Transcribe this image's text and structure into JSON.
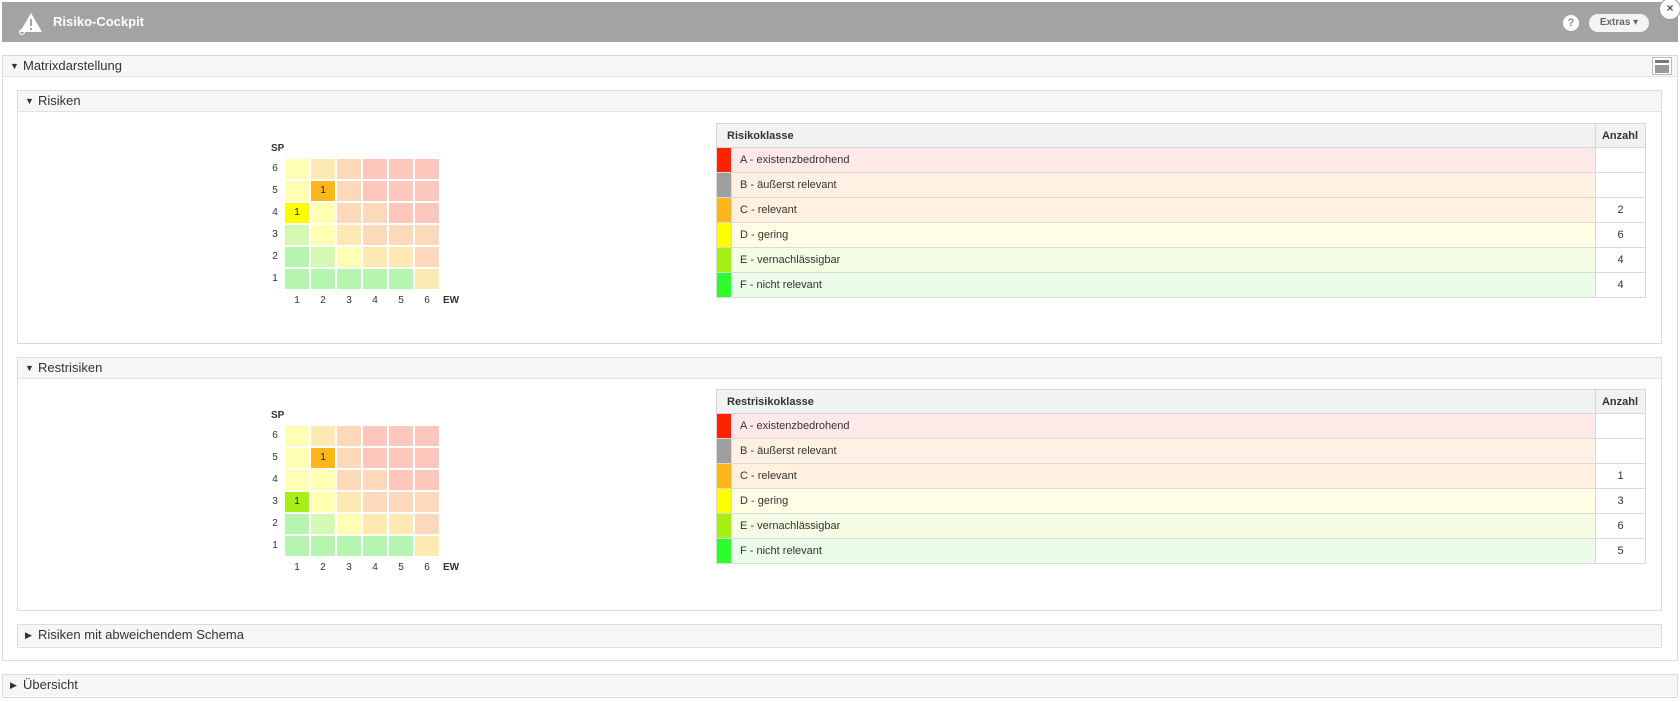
{
  "app": {
    "title": "Risiko-Cockpit",
    "help_icon": "?",
    "extras_label": "Extras ▾",
    "close_icon": "×"
  },
  "panels": {
    "matrix": {
      "title": "Matrixdarstellung"
    },
    "risks": {
      "title": "Risiken"
    },
    "residual": {
      "title": "Restrisiken"
    },
    "deviating": {
      "title": "Risiken mit abweichendem Schema"
    },
    "overview": {
      "title": "Übersicht"
    }
  },
  "matrix_axes": {
    "ylabel": "SP",
    "xlabel": "EW",
    "ticks": [
      "1",
      "2",
      "3",
      "4",
      "5",
      "6"
    ]
  },
  "palette": {
    "A": "#ff2200",
    "B": "#9e9e9e",
    "C": "#ffb61e",
    "D": "#ffff00",
    "E": "#a6ef17",
    "F": "#2dfc2d",
    "rowA": "#ffe8e8",
    "rowB": "#fff0e4",
    "rowC": "#fff0e0",
    "rowD": "#fffde4",
    "rowE": "#f5fce4",
    "rowF": "#eafbe8",
    "cell_green": "#b6f5b0",
    "cell_lightgreen": "#d4f9b2",
    "cell_yellow": "#feffb2",
    "cell_cream": "#fde9b2",
    "cell_peach": "#fdd9bc",
    "cell_red": "#fdc7bd"
  },
  "matrix_colors": [
    [
      "cell_yellow",
      "cell_cream",
      "cell_peach",
      "cell_red",
      "cell_red",
      "cell_red"
    ],
    [
      "cell_yellow",
      "cell_cream",
      "cell_peach",
      "cell_red",
      "cell_red",
      "cell_red"
    ],
    [
      "cell_yellow",
      "cell_yellow",
      "cell_peach",
      "cell_peach",
      "cell_red",
      "cell_red"
    ],
    [
      "cell_lightgreen",
      "cell_yellow",
      "cell_cream",
      "cell_peach",
      "cell_peach",
      "cell_peach"
    ],
    [
      "cell_green",
      "cell_lightgreen",
      "cell_yellow",
      "cell_cream",
      "cell_cream",
      "cell_peach"
    ],
    [
      "cell_green",
      "cell_green",
      "cell_green",
      "cell_green",
      "cell_green",
      "cell_cream"
    ]
  ],
  "risks_matrix_marks": [
    {
      "sp": 5,
      "ew": 2,
      "value": "1",
      "color": "#ffb61e"
    },
    {
      "sp": 4,
      "ew": 1,
      "value": "1",
      "color": "#ffff00"
    }
  ],
  "residual_matrix_marks": [
    {
      "sp": 5,
      "ew": 2,
      "value": "1",
      "color": "#ffb61e"
    },
    {
      "sp": 3,
      "ew": 1,
      "value": "1",
      "color": "#a6ef17"
    }
  ],
  "risks_table": {
    "col_class": "Risikoklasse",
    "col_count": "Anzahl",
    "rows": [
      {
        "key": "A",
        "label": "A - existenzbedrohend",
        "count": ""
      },
      {
        "key": "B",
        "label": "B - äußerst relevant",
        "count": ""
      },
      {
        "key": "C",
        "label": "C - relevant",
        "count": "2"
      },
      {
        "key": "D",
        "label": "D - gering",
        "count": "6"
      },
      {
        "key": "E",
        "label": "E - vernachlässigbar",
        "count": "4"
      },
      {
        "key": "F",
        "label": "F - nicht relevant",
        "count": "4"
      }
    ]
  },
  "residual_table": {
    "col_class": "Restrisikoklasse",
    "col_count": "Anzahl",
    "rows": [
      {
        "key": "A",
        "label": "A - existenzbedrohend",
        "count": ""
      },
      {
        "key": "B",
        "label": "B - äußerst relevant",
        "count": ""
      },
      {
        "key": "C",
        "label": "C - relevant",
        "count": "1"
      },
      {
        "key": "D",
        "label": "D - gering",
        "count": "3"
      },
      {
        "key": "E",
        "label": "E - vernachlässigbar",
        "count": "6"
      },
      {
        "key": "F",
        "label": "F - nicht relevant",
        "count": "5"
      }
    ]
  }
}
